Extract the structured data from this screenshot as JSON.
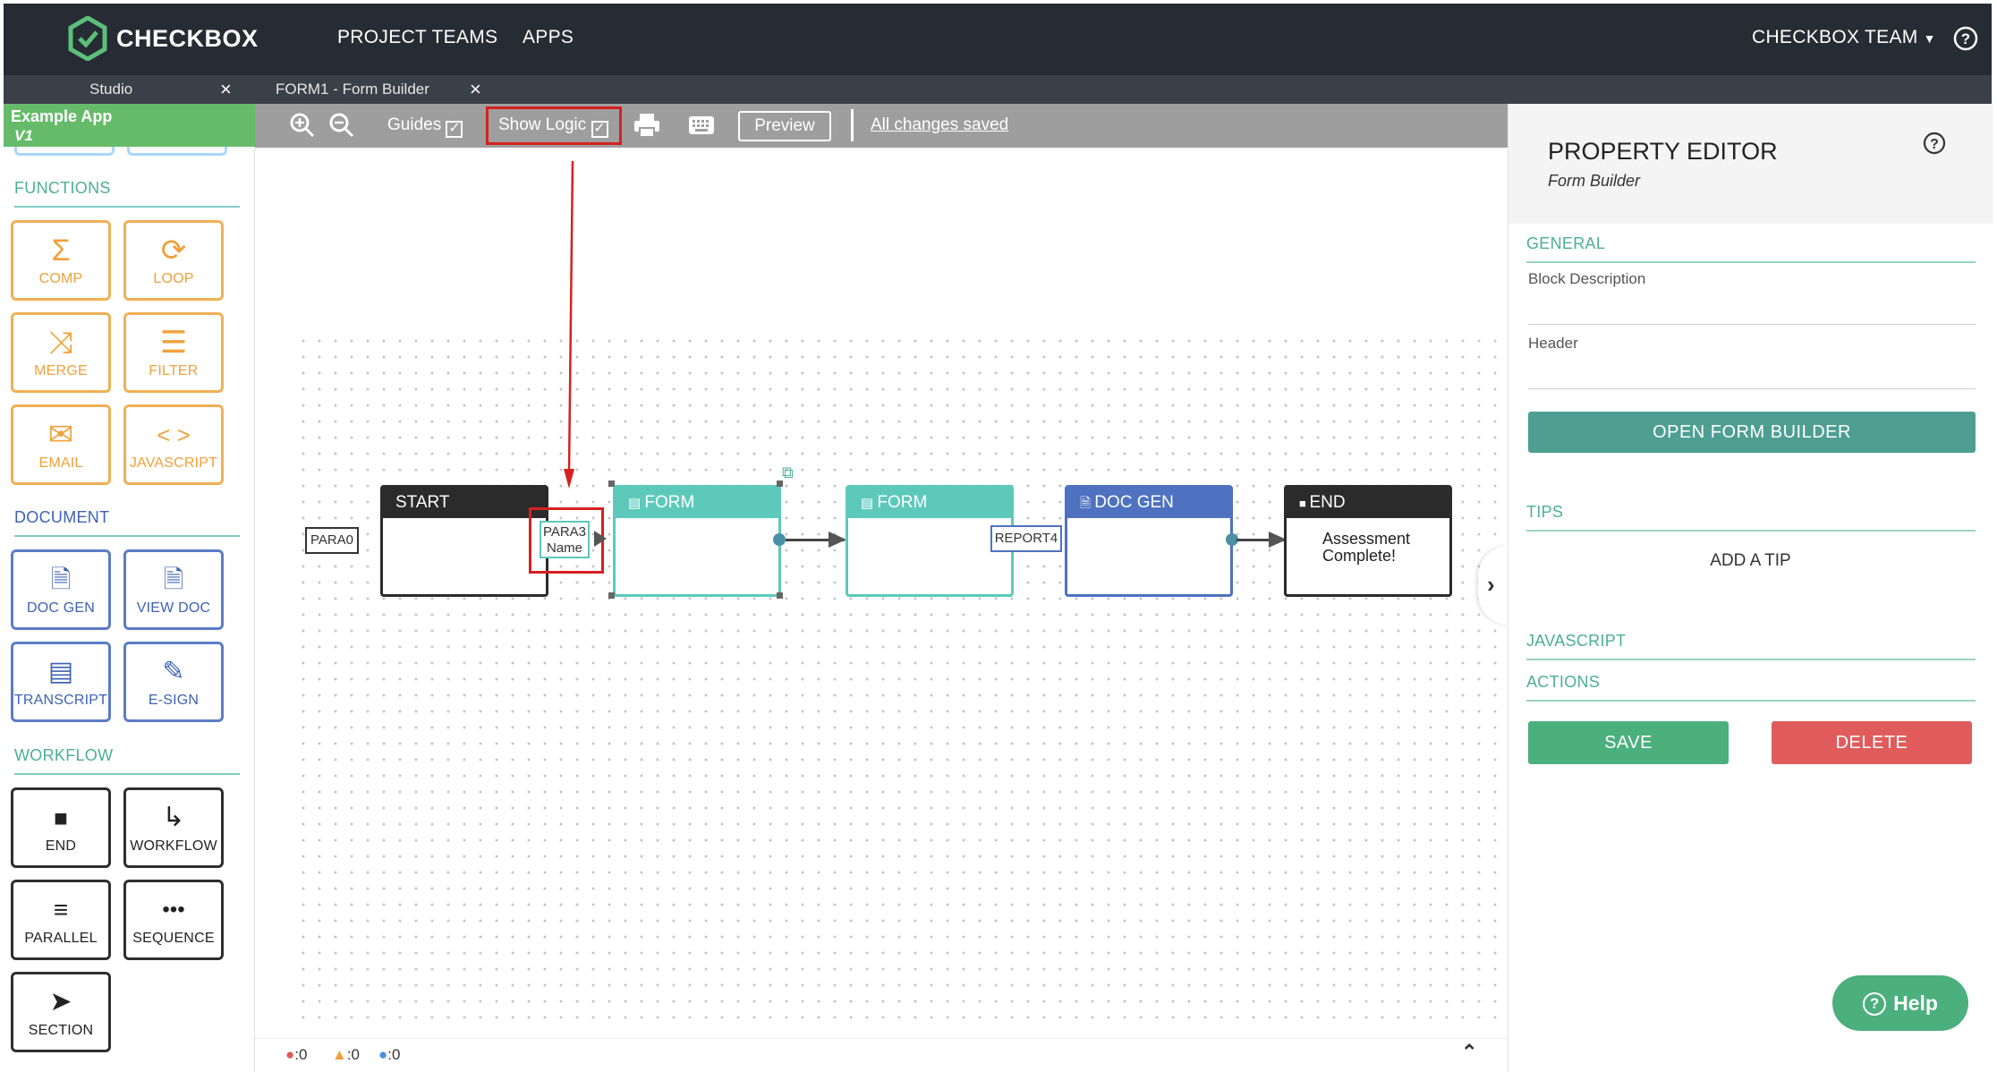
{
  "header": {
    "brand": "CHECKBOX",
    "nav": [
      "PROJECT TEAMS",
      "APPS"
    ],
    "team": "CHECKBOX TEAM",
    "help_icon": "question-circle-icon"
  },
  "tabs": [
    {
      "label": "Studio",
      "close": "×"
    },
    {
      "label": "FORM1 - Form Builder",
      "close": "×"
    }
  ],
  "sidebar": {
    "app_name": "Example App",
    "app_version": "V1",
    "functions_title": "FUNCTIONS",
    "functions": [
      {
        "label": "COMP",
        "icon": "sigma-icon"
      },
      {
        "label": "LOOP",
        "icon": "loop-icon"
      },
      {
        "label": "MERGE",
        "icon": "merge-icon"
      },
      {
        "label": "FILTER",
        "icon": "filter-icon"
      },
      {
        "label": "EMAIL",
        "icon": "envelope-icon"
      },
      {
        "label": "JAVASCRIPT",
        "icon": "code-icon"
      }
    ],
    "document_title": "DOCUMENT",
    "document": [
      {
        "label": "DOC GEN",
        "icon": "doc-plus-icon"
      },
      {
        "label": "VIEW DOC",
        "icon": "doc-icon"
      },
      {
        "label": "TRANSCRIPT",
        "icon": "list-icon"
      },
      {
        "label": "E-SIGN",
        "icon": "pencil-icon"
      }
    ],
    "workflow_title": "WORKFLOW",
    "workflow": [
      {
        "label": "END",
        "icon": "square-icon"
      },
      {
        "label": "WORKFLOW",
        "icon": "return-arrow-icon"
      },
      {
        "label": "PARALLEL",
        "icon": "parallel-icon"
      },
      {
        "label": "SEQUENCE",
        "icon": "sequence-icon"
      },
      {
        "label": "SECTION",
        "icon": "chevron-block-icon"
      }
    ]
  },
  "toolbar": {
    "guides_label": "Guides",
    "show_logic_label": "Show Logic",
    "preview_label": "Preview",
    "status": "All changes saved",
    "guides_checked": true,
    "show_logic_checked": true
  },
  "canvas": {
    "nodes": [
      {
        "title": "START",
        "color": "#2b2b2b"
      },
      {
        "title": "FORM",
        "color": "#5cc9bb"
      },
      {
        "title": "FORM",
        "color": "#5cc9bb"
      },
      {
        "title": "DOC GEN",
        "color": "#4e72c0"
      },
      {
        "title": "END",
        "color": "#2b2b2b",
        "body": "Assessment Complete!"
      }
    ],
    "ports": {
      "para0": "PARA0",
      "para3": "PARA3",
      "para3_sub": "Name",
      "report4": "REPORT4"
    }
  },
  "status_bar": {
    "errors": ":0",
    "warnings": ":0",
    "info": ":0"
  },
  "property_editor": {
    "title": "PROPERTY EDITOR",
    "subtitle": "Form Builder",
    "help_icon": "question-circle-icon",
    "general": "GENERAL",
    "block_description": "Block Description",
    "header": "Header",
    "open_form_builder": "OPEN FORM BUILDER",
    "tips": "TIPS",
    "add_tip": "ADD A TIP",
    "javascript": "JAVASCRIPT",
    "actions": "ACTIONS",
    "save": "SAVE",
    "delete": "DELETE"
  },
  "help_button": "Help",
  "colors": {
    "accent": "#4caf93",
    "danger": "#e05c5c",
    "highlight": "#d62020"
  }
}
